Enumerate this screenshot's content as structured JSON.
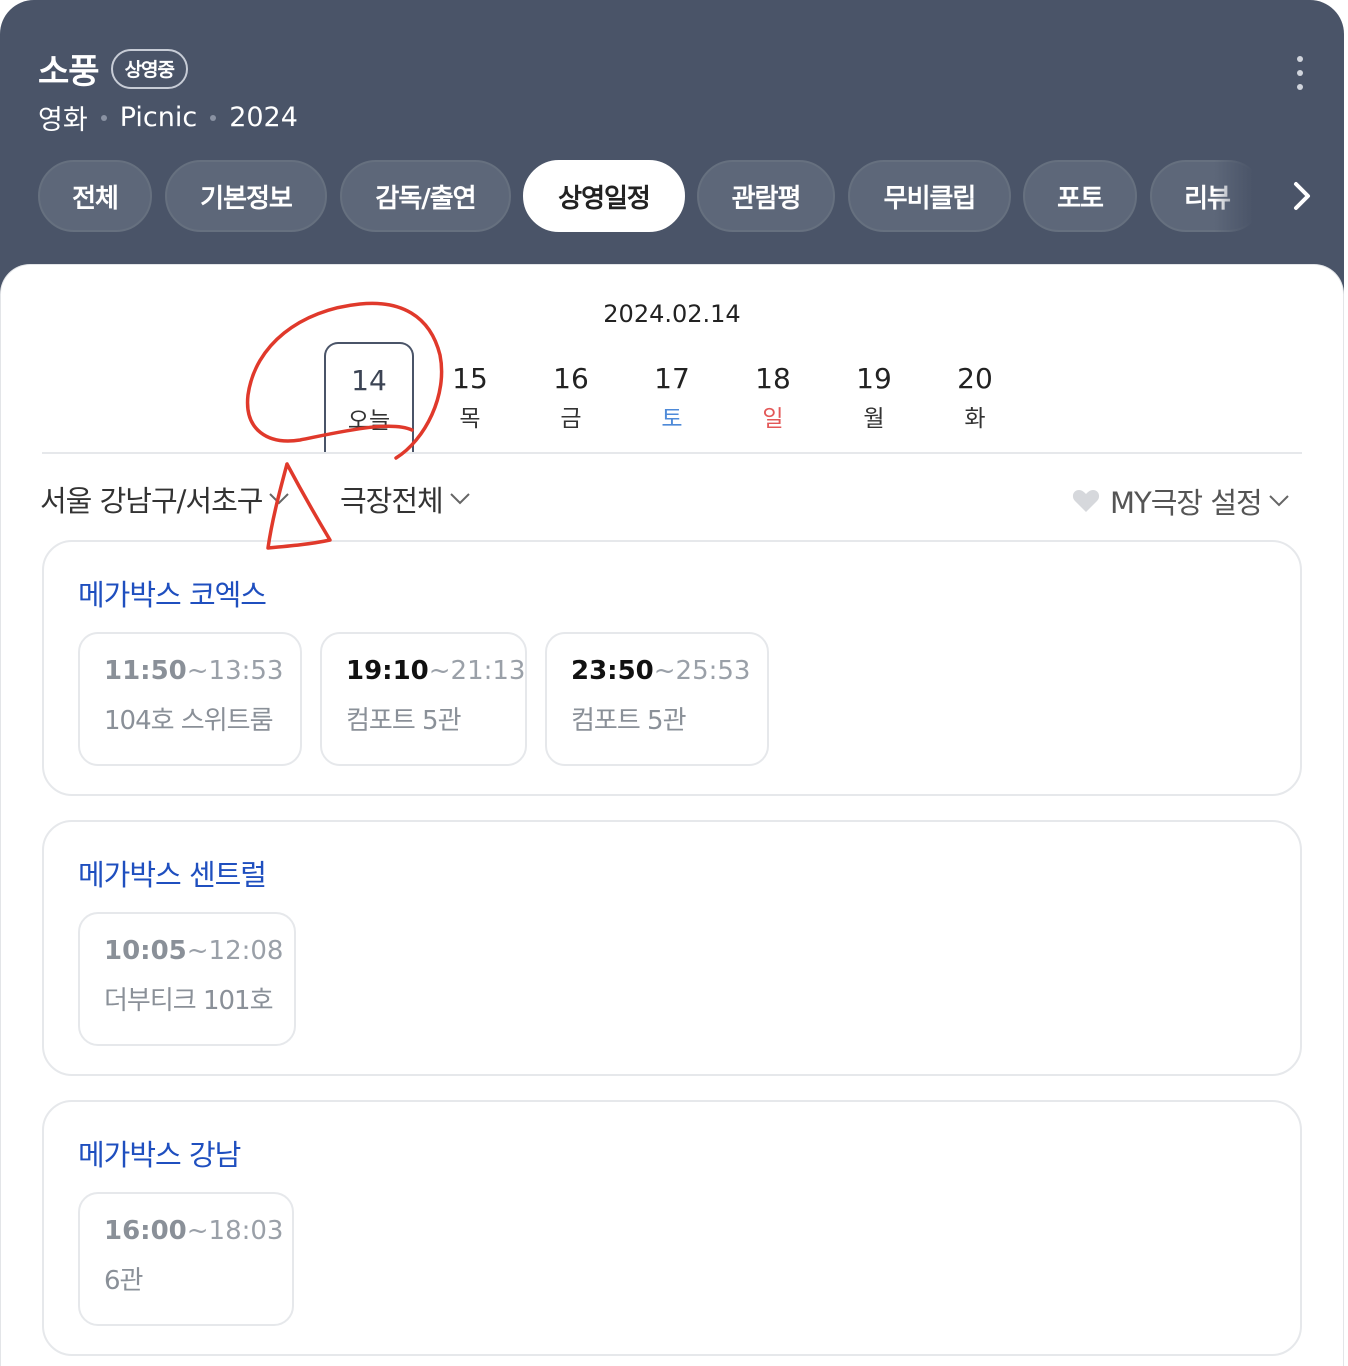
{
  "header": {
    "title": "소풍",
    "status_badge": "상영중",
    "meta": [
      "영화",
      "Picnic",
      "2024"
    ],
    "more_icon": "vertical-ellipsis-icon"
  },
  "tabs": [
    {
      "label": "전체",
      "active": false
    },
    {
      "label": "기본정보",
      "active": false
    },
    {
      "label": "감독/출연",
      "active": false
    },
    {
      "label": "상영일정",
      "active": true
    },
    {
      "label": "관람평",
      "active": false
    },
    {
      "label": "무비클립",
      "active": false
    },
    {
      "label": "포토",
      "active": false
    },
    {
      "label": "리뷰",
      "active": false
    }
  ],
  "tab_next_icon": "chevron-right-icon",
  "schedule": {
    "date": "2024.02.14",
    "days": [
      {
        "num": "14",
        "weekday": "오늘",
        "selected": true
      },
      {
        "num": "15",
        "weekday": "목"
      },
      {
        "num": "16",
        "weekday": "금"
      },
      {
        "num": "17",
        "weekday": "토"
      },
      {
        "num": "18",
        "weekday": "일"
      },
      {
        "num": "19",
        "weekday": "월"
      },
      {
        "num": "20",
        "weekday": "화"
      }
    ]
  },
  "filters": {
    "region": "서울 강남구/서초구",
    "theater": "극장전체",
    "my_theater": "MY극장 설정",
    "heart_icon": "heart-icon",
    "dropdown_icon": "chevron-down-icon"
  },
  "theaters": [
    {
      "name": "메가박스 코엑스",
      "showtimes": [
        {
          "start": "11:50",
          "end": "~13:53",
          "room": "104호 스위트룸"
        },
        {
          "start": "19:10",
          "end": "~21:13",
          "room": "컴포트 5관"
        },
        {
          "start": "23:50",
          "end": "~25:53",
          "room": "컴포트 5관"
        }
      ]
    },
    {
      "name": "메가박스 센트럴",
      "showtimes": [
        {
          "start": "10:05",
          "end": "~12:08",
          "room": "더부티크 101호"
        }
      ]
    },
    {
      "name": "메가박스 강남",
      "showtimes": [
        {
          "start": "16:00",
          "end": "~18:03",
          "room": "6관"
        }
      ]
    }
  ],
  "colors": {
    "header_bg": "#4a5468",
    "theater_link": "#1f4fbf",
    "saturday": "#4e8ad8",
    "sunday": "#e35858",
    "annotation": "#e0392b"
  }
}
